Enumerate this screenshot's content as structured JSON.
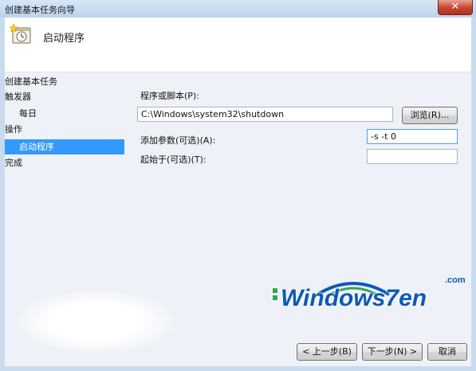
{
  "window": {
    "title": "创建基本任务向导",
    "close_glyph": "✕"
  },
  "header": {
    "title": "启动程序",
    "icon": "task-wizard-icon"
  },
  "nav": {
    "items": [
      {
        "label": "创建基本任务",
        "selected": false,
        "indent": false
      },
      {
        "label": "触发器",
        "selected": false,
        "indent": false
      },
      {
        "label": "每日",
        "selected": false,
        "indent": true
      },
      {
        "label": "操作",
        "selected": false,
        "indent": false
      },
      {
        "label": "启动程序",
        "selected": true,
        "indent": true
      },
      {
        "label": "完成",
        "selected": false,
        "indent": false
      }
    ]
  },
  "form": {
    "program_label": "程序或脚本(P):",
    "program_value": "C:\\Windows\\system32\\shutdown",
    "browse_label": "浏览(R)...",
    "args_label": "添加参数(可选)(A):",
    "args_value": "-s -t 0",
    "start_in_label": "起始于(可选)(T):",
    "start_in_value": ""
  },
  "footer": {
    "back_label": "< 上一步(B)",
    "next_label": "下一步(N) >",
    "cancel_label": "取消"
  },
  "watermark": {
    "text": "Windows7en",
    "suffix": ".com"
  },
  "colors": {
    "selection": "#3399ff",
    "accent": "#0e58b8",
    "close": "#c7442e"
  }
}
